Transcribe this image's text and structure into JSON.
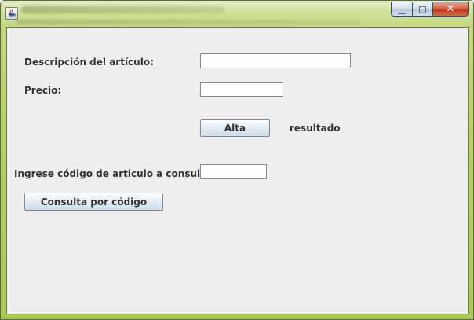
{
  "window": {
    "controls": {
      "minimize_glyph": "▁",
      "maximize_glyph": "□",
      "close_glyph": "✕"
    }
  },
  "form": {
    "descripcion_label": "Descripción del artículo:",
    "descripcion_value": "",
    "precio_label": "Precio:",
    "precio_value": "",
    "alta_button": "Alta",
    "resultado_label": "resultado",
    "codigo_label": "Ingrese código de articulo a consultar:",
    "codigo_value": "",
    "consulta_button": "Consulta por código"
  },
  "colors": {
    "panel_background": "#eeeeee",
    "close_button": "#c2381b",
    "button_gradient_top": "#ffffff",
    "button_gradient_bottom": "#cfdceb"
  }
}
